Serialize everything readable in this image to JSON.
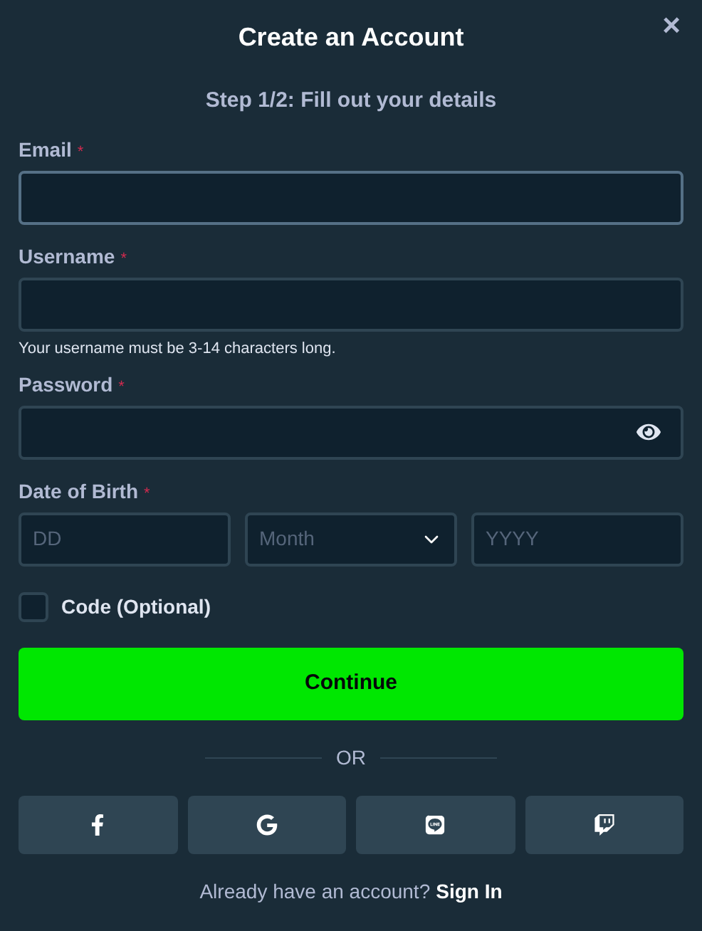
{
  "dialog": {
    "title": "Create an Account",
    "close": "×",
    "step": "Step 1/2: Fill out your details"
  },
  "fields": [
    {
      "kind": "text",
      "label": "Email",
      "required_mark": "*"
    },
    {
      "kind": "text",
      "label": "Username",
      "required_mark": "*",
      "hint": "Your username must be 3-14 characters long."
    },
    {
      "kind": "password",
      "label": "Password",
      "required_mark": "*"
    }
  ],
  "date_of_birth": {
    "label": "Date of Birth",
    "required_mark": "*",
    "parts": [
      {
        "kind": "input",
        "placeholder": "DD"
      },
      {
        "kind": "select",
        "placeholder": "Month"
      },
      {
        "kind": "input",
        "placeholder": "YYYY"
      }
    ]
  },
  "code": {
    "label": "Code (Optional)",
    "checked": false
  },
  "continue_button": "Continue",
  "divider": "OR",
  "social_buttons": [
    {
      "kind": "facebook"
    },
    {
      "kind": "google"
    },
    {
      "kind": "line"
    },
    {
      "kind": "twitch"
    }
  ],
  "footer": {
    "text": "Already have an account?",
    "link": "Sign In"
  }
}
